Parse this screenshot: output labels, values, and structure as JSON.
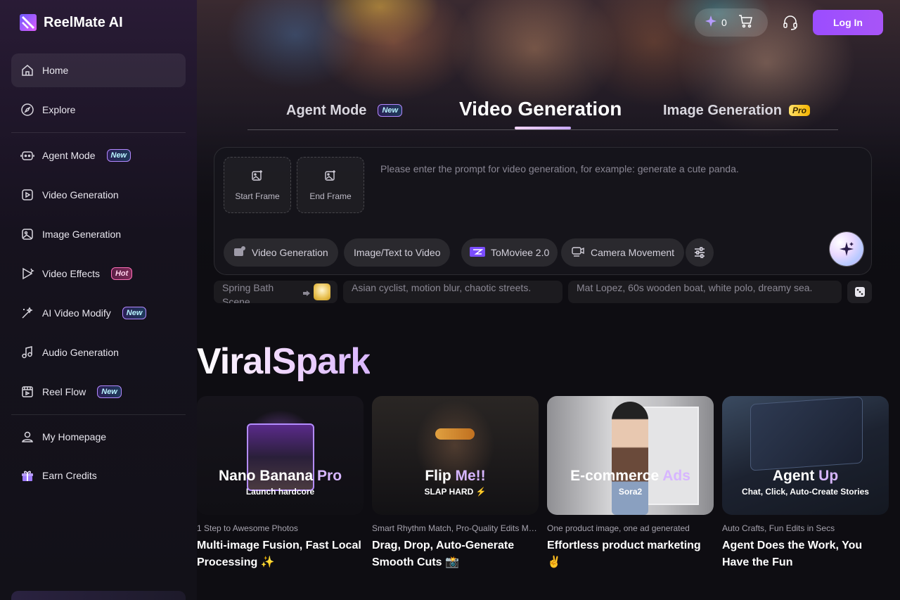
{
  "brand": {
    "name": "ReelMate AI"
  },
  "sidebar": {
    "items": [
      {
        "label": "Home",
        "icon": "home-icon"
      },
      {
        "label": "Explore",
        "icon": "compass-icon"
      },
      {
        "label": "Agent Mode",
        "icon": "robot-icon",
        "badge": "New"
      },
      {
        "label": "Video Generation",
        "icon": "video-icon"
      },
      {
        "label": "Image Generation",
        "icon": "image-icon"
      },
      {
        "label": "Video Effects",
        "icon": "effects-icon",
        "badge": "Hot"
      },
      {
        "label": "AI Video Modify",
        "icon": "magic-wand-icon",
        "badge": "New"
      },
      {
        "label": "Audio Generation",
        "icon": "music-note-icon"
      },
      {
        "label": "Reel Flow",
        "icon": "film-icon",
        "badge": "New"
      },
      {
        "label": "My Homepage",
        "icon": "user-icon"
      },
      {
        "label": "Earn Credits",
        "icon": "gift-icon"
      }
    ]
  },
  "header": {
    "credits": "0",
    "login_label": "Log In"
  },
  "mode_tabs": [
    {
      "label": "Agent Mode",
      "badge": "New"
    },
    {
      "label": "Video Generation",
      "active": true
    },
    {
      "label": "Image Generation",
      "badge": "Pro"
    }
  ],
  "prompt": {
    "start_frame": "Start Frame",
    "end_frame": "End Frame",
    "placeholder": "Please enter the prompt for video generation, for example: generate a cute panda.",
    "chips": [
      "Video Generation",
      "Image/Text to Video",
      "ToMoviee 2.0",
      "Camera Movement"
    ]
  },
  "suggestions": [
    {
      "text": "Spring Bath Scene"
    },
    {
      "text": "Asian cyclist, motion blur, chaotic streets."
    },
    {
      "text": "Mat Lopez, 60s wooden boat, white polo, dreamy sea."
    }
  ],
  "section": {
    "title": "ViralSpark",
    "cards": [
      {
        "thumb_title": "Nano Banana",
        "thumb_accent": "Pro",
        "thumb_sub": "Launch hardcore",
        "subtitle": "1 Step to Awesome Photos",
        "title": "Multi-image Fusion, Fast Local Processing ✨"
      },
      {
        "thumb_title": "Flip",
        "thumb_accent": "Me!!",
        "thumb_sub": "SLAP HARD ⚡",
        "subtitle": "Smart Rhythm Match, Pro-Quality Edits Made Easy",
        "title": "Drag, Drop, Auto-Generate Smooth Cuts 📸"
      },
      {
        "thumb_title": "E-commerce",
        "thumb_accent": "Ads",
        "thumb_sub": "Sora2",
        "subtitle": "One product image, one ad generated",
        "title": "Effortless product marketing ✌"
      },
      {
        "thumb_title": "Agent",
        "thumb_accent": "Up",
        "thumb_sub": "Chat, Click, Auto-Create Stories",
        "subtitle": "Auto Crafts, Fun Edits in Secs",
        "title": "Agent Does the Work, You Have the Fun"
      }
    ]
  },
  "colors": {
    "accent": "#a855f7",
    "badge_new": "#b388ff",
    "badge_hot": "#ff6fb8"
  }
}
